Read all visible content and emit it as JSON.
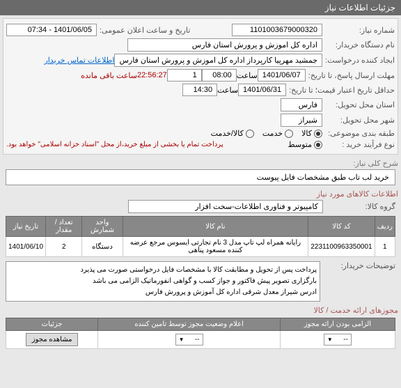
{
  "header": {
    "title": "جزئیات اطلاعات نیاز"
  },
  "fields": {
    "need_no_label": "شماره نیاز:",
    "need_no": "1101003679000320",
    "announce_label": "تاریخ و ساعت اعلان عمومی:",
    "announce": "1401/06/05 - 07:34",
    "buyer_org_label": "نام دستگاه خریدار:",
    "buyer_org": "اداره کل اموزش و پرورش استان فارس",
    "creator_label": "ایجاد کننده درخواست:",
    "creator": "جمشید مهرپیا کارپرداز اداره کل اموزش و پرورش استان فارس",
    "contact_link": "اطلاعات تماس خریدار",
    "reply_deadline_label": "مهلت ارسال پاسخ، تا تاریخ:",
    "reply_date": "1401/06/07",
    "time_label": "ساعت",
    "reply_time": "08:00",
    "remain_count": "1",
    "countdown": "22:56:27",
    "countdown_suffix": "ساعت باقی مانده",
    "validity_label": "حداقل تاریخ اعتبار قیمت؛ تا تاریخ:",
    "validity_date": "1401/06/31",
    "validity_time": "14:30",
    "province_label": "استان محل تحویل:",
    "province": "فارس",
    "city_label": "شهر محل تحویل:",
    "city": "شیراز",
    "category_label": "طبقه بندی موضوعی:",
    "cat_goods": "کالا",
    "cat_service": "خدمت",
    "cat_both": "کالا/خدمت",
    "buy_type_label": "نوع فرآیند خرید :",
    "buy_type_note": "پرداخت تمام یا بخشی از مبلغ خرید،از محل \"اسناد خزانه اسلامی\" خواهد بود.",
    "opt_mid": "متوسط",
    "desc_title": "شرح کلی نیاز:",
    "desc_value": "خرید لب تاب طبق مشخصات فایل پیوست",
    "goods_info_title": "اطلاعات کالاهای مورد نیاز",
    "group_label": "گروه کالا:",
    "group_value": "کامپیوتر و فناوری اطلاعات-سخت افزار",
    "buyer_notes_label": "توضیحات خریدار:",
    "buyer_notes_l1": "پرداخت پس از تحویل و مطابقت کالا با مشخصات فایل درخواستی صورت می پذیرد",
    "buyer_notes_l2": "بارگزاری تصویر پیش فاکتور و جواز کسب و گواهی انفورماتیک الزامی می باشد",
    "buyer_notes_l3": "ادرس شیراز معدل شرقی اداره کل آموزش و پرورش فارس",
    "licenses_title": "مجوزهای ارائه خدمت / کالا"
  },
  "goods_table": {
    "headers": {
      "row": "ردیف",
      "code": "کد کالا",
      "name": "نام کالا",
      "unit": "واحد شمارش",
      "qty": "تعداد / مقدار",
      "date": "تاریخ نیاز"
    },
    "rows": [
      {
        "row": "1",
        "code": "2231100963350001",
        "name": "رایانه همراه لپ تاپ مدل 3 نام تجارتی ایسوس مرجع عرضه کننده مسعود پناهی",
        "unit": "دستگاه",
        "qty": "2",
        "date": "1401/06/10"
      }
    ]
  },
  "license_table": {
    "headers": {
      "mandatory": "الزامی بودن ارائه مجوز",
      "status": "اعلام وضعیت مجوز توسط تامین کننده",
      "details": "جزئیات"
    },
    "view_btn": "مشاهده مجوز",
    "dash": "--"
  }
}
